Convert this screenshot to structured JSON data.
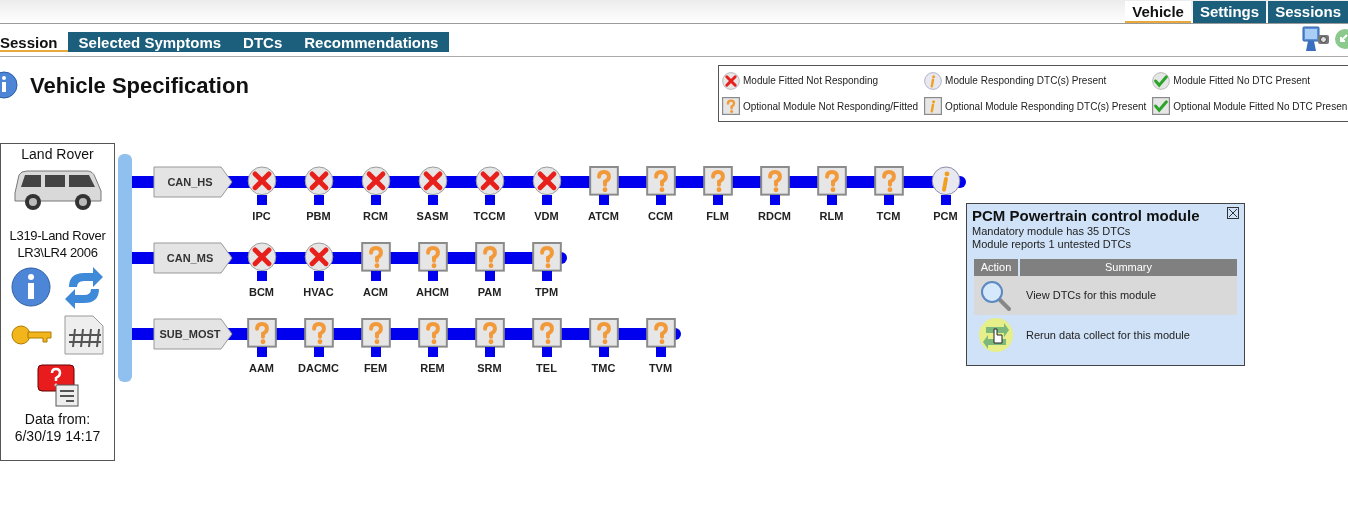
{
  "top_tabs": [
    {
      "label": "Vehicle",
      "selected": true
    },
    {
      "label": "Settings",
      "selected": false
    },
    {
      "label": "Sessions",
      "selected": false
    }
  ],
  "sub_tabs": [
    {
      "label": "Session",
      "selected": true
    },
    {
      "label": "Selected Symptoms",
      "selected": false
    },
    {
      "label": "DTCs",
      "selected": false
    },
    {
      "label": "Recommendations",
      "selected": false
    }
  ],
  "title": "Vehicle Specification",
  "legend": [
    {
      "kind": "not_responding",
      "label": "Module Fitted Not Responding"
    },
    {
      "kind": "dtc_present",
      "label": "Module Responding DTC(s) Present"
    },
    {
      "kind": "no_dtc",
      "label": "Module Fitted No DTC Present"
    },
    {
      "kind": "optional_not_responding",
      "label": "Optional Module Not Responding/Fitted"
    },
    {
      "kind": "optional_dtc_present",
      "label": "Optional Module Responding DTC(s) Present"
    },
    {
      "kind": "optional_no_dtc",
      "label": "Optional Module Fitted No DTC Presen"
    }
  ],
  "vehicle_panel": {
    "make": "Land Rover",
    "model_lines": [
      "L319-Land Rover",
      "LR3\\LR4 2006"
    ],
    "data_from_label": "Data from:",
    "data_from_time": "6/30/19 14:17"
  },
  "buses": [
    {
      "name": "CAN_HS",
      "modules": [
        {
          "name": "IPC",
          "kind": "not_responding"
        },
        {
          "name": "PBM",
          "kind": "not_responding"
        },
        {
          "name": "RCM",
          "kind": "not_responding"
        },
        {
          "name": "SASM",
          "kind": "not_responding"
        },
        {
          "name": "TCCM",
          "kind": "not_responding"
        },
        {
          "name": "VDM",
          "kind": "not_responding"
        },
        {
          "name": "ATCM",
          "kind": "optional_not_responding"
        },
        {
          "name": "CCM",
          "kind": "optional_not_responding"
        },
        {
          "name": "FLM",
          "kind": "optional_not_responding"
        },
        {
          "name": "RDCM",
          "kind": "optional_not_responding"
        },
        {
          "name": "RLM",
          "kind": "optional_not_responding"
        },
        {
          "name": "TCM",
          "kind": "optional_not_responding"
        },
        {
          "name": "PCM",
          "kind": "dtc_present"
        }
      ]
    },
    {
      "name": "CAN_MS",
      "modules": [
        {
          "name": "BCM",
          "kind": "not_responding"
        },
        {
          "name": "HVAC",
          "kind": "not_responding"
        },
        {
          "name": "ACM",
          "kind": "optional_not_responding"
        },
        {
          "name": "AHCM",
          "kind": "optional_not_responding"
        },
        {
          "name": "PAM",
          "kind": "optional_not_responding"
        },
        {
          "name": "TPM",
          "kind": "optional_not_responding"
        }
      ]
    },
    {
      "name": "SUB_MOST",
      "modules": [
        {
          "name": "AAM",
          "kind": "optional_not_responding"
        },
        {
          "name": "DACMC",
          "kind": "optional_not_responding"
        },
        {
          "name": "FEM",
          "kind": "optional_not_responding"
        },
        {
          "name": "REM",
          "kind": "optional_not_responding"
        },
        {
          "name": "SRM",
          "kind": "optional_not_responding"
        },
        {
          "name": "TEL",
          "kind": "optional_not_responding"
        },
        {
          "name": "TMC",
          "kind": "optional_not_responding"
        },
        {
          "name": "TVM",
          "kind": "optional_not_responding"
        }
      ]
    }
  ],
  "popup": {
    "title": "PCM Powertrain control module",
    "lines": [
      "Mandatory module has 35 DTCs",
      "Module reports 1 untested DTCs"
    ],
    "columns": [
      "Action",
      "Summary"
    ],
    "actions": [
      {
        "kind": "view_dtcs",
        "label": "View DTCs for this module"
      },
      {
        "kind": "rerun",
        "label": "Rerun data collect for this module"
      }
    ]
  }
}
